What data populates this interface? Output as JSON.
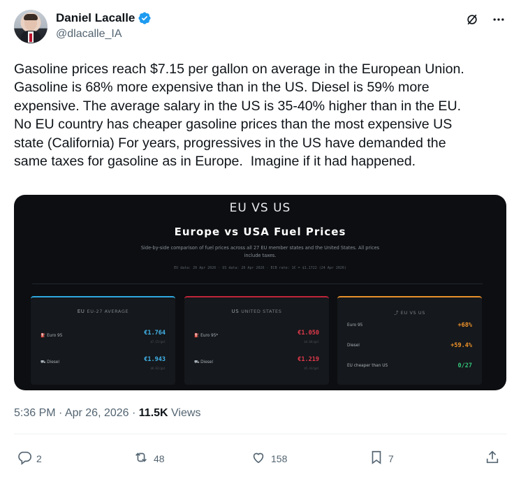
{
  "author": {
    "name": "Daniel Lacalle",
    "handle": "@dlacalle_IA"
  },
  "tweet": {
    "text": "Gasoline prices reach $7.15 per gallon on average in the European Union.\nGasoline is 68% more expensive than in the US. Diesel is 59% more\nexpensive. The average salary in the US is 35-40% higher than in the EU.\nNo EU country has cheaper gasoline prices than the most expensive US\nstate (California) For years, progressives in the US have demanded the\nsame taxes for gasoline as in Europe.  Imagine if it had happened."
  },
  "media": {
    "heading": "EU VS US",
    "title": "Europe vs USA Fuel Prices",
    "subtitle": "Side-by-side comparison of fuel prices across all 27 EU member states and the United States. All prices include taxes.",
    "meta": "EU data: 20 Apr 2026 · US data: 20 Apr 2026 · ECB rate: 1€ = $1.1722 (24 Apr 2026)",
    "eu_card": {
      "tag": "EU",
      "title": "EU-27 AVERAGE",
      "rows": [
        {
          "label": "Euro 95",
          "value": "€1.764",
          "sub": "$7.15/gal"
        },
        {
          "label": "Diesel",
          "value": "€1.943",
          "sub": "$8.62/gal"
        }
      ]
    },
    "us_card": {
      "tag": "US",
      "title": "UNITED STATES",
      "rows": [
        {
          "label": "Euro 95*",
          "value": "€1.050",
          "sub": "$4.66/gal"
        },
        {
          "label": "Diesel",
          "value": "€1.219",
          "sub": "$5.41/gal"
        }
      ]
    },
    "compare_card": {
      "title": "EU VS US",
      "rows": [
        {
          "label": "Euro 95",
          "value": "+68%"
        },
        {
          "label": "Diesel",
          "value": "+59.4%"
        },
        {
          "label": "EU cheaper than US",
          "value": "0/27"
        }
      ]
    },
    "colors": {
      "eu": "#2ea8e0",
      "us": "#c0253a",
      "compare": "#e8902c"
    }
  },
  "timestamp": {
    "time": "5:36 PM",
    "date": "Apr 26, 2026",
    "views_count": "11.5K",
    "views_label": "Views"
  },
  "actions": {
    "replies": "2",
    "reposts": "48",
    "likes": "158",
    "bookmarks": "7"
  },
  "icons": [
    "verified-badge-icon",
    "grok-slash-icon",
    "more-icon",
    "reply-icon",
    "repost-icon",
    "like-icon",
    "bookmark-icon",
    "share-icon",
    "fuel-icon",
    "car-icon",
    "trend-icon"
  ]
}
